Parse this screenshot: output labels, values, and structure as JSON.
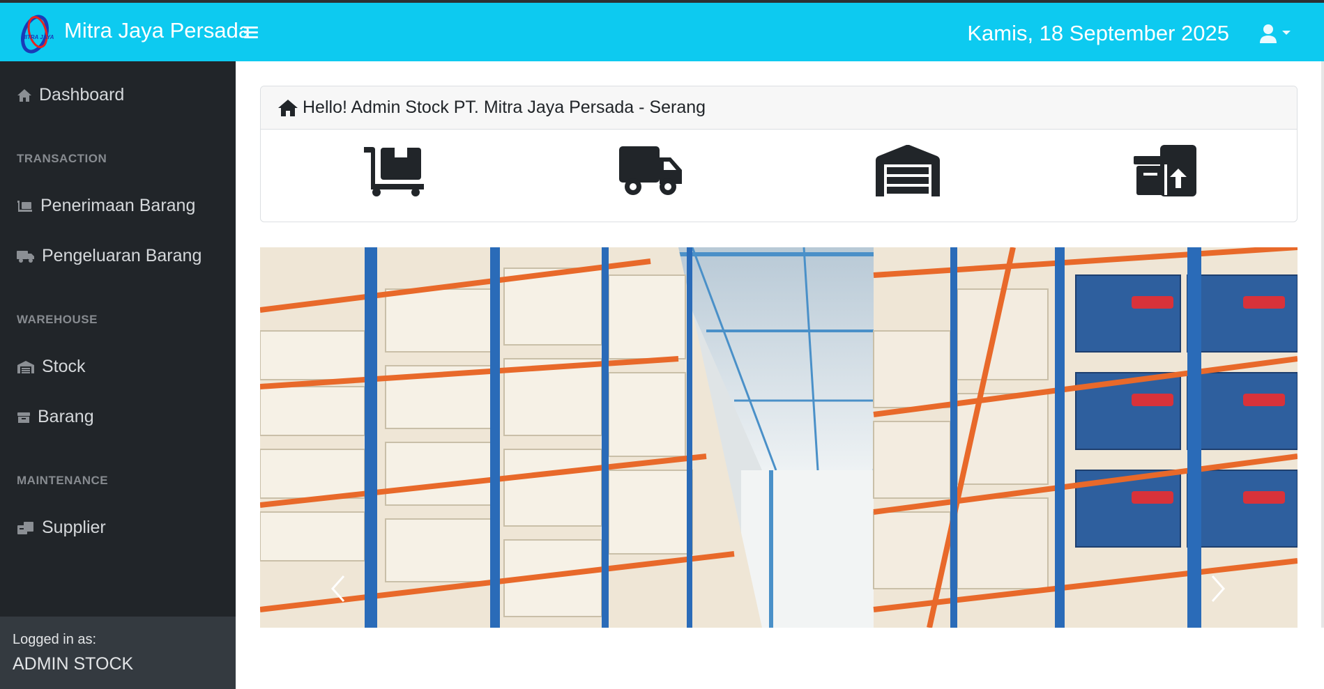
{
  "app": {
    "brand": "Mitra Jaya Persada",
    "logo_text": "MITRA JAYA"
  },
  "header": {
    "date": "Kamis, 18 September 2025"
  },
  "sidebar": {
    "items": [
      {
        "label": "Dashboard",
        "icon": "home-icon"
      },
      {
        "heading": "TRANSACTION"
      },
      {
        "label": "Penerimaan Barang",
        "icon": "dolly-icon"
      },
      {
        "label": "Pengeluaran Barang",
        "icon": "truck-icon"
      },
      {
        "heading": "WAREHOUSE"
      },
      {
        "label": "Stock",
        "icon": "warehouse-icon"
      },
      {
        "label": "Barang",
        "icon": "archive-icon"
      },
      {
        "heading": "MAINTENANCE"
      },
      {
        "label": "Supplier",
        "icon": "supplier-icon"
      }
    ],
    "footer": {
      "label": "Logged in as:",
      "user": "ADMIN STOCK"
    }
  },
  "welcome": {
    "text": "Hello! Admin Stock PT. Mitra Jaya Persada - Serang",
    "quick_links": [
      "dolly-icon",
      "truck-icon",
      "warehouse-icon",
      "box-upload-icon"
    ]
  },
  "carousel": {
    "controls": [
      "chevron-left-icon",
      "chevron-right-icon"
    ]
  },
  "colors": {
    "navbar": "#0dcaf0",
    "sidebar": "#212529",
    "sidebar_footer": "#343a40"
  }
}
